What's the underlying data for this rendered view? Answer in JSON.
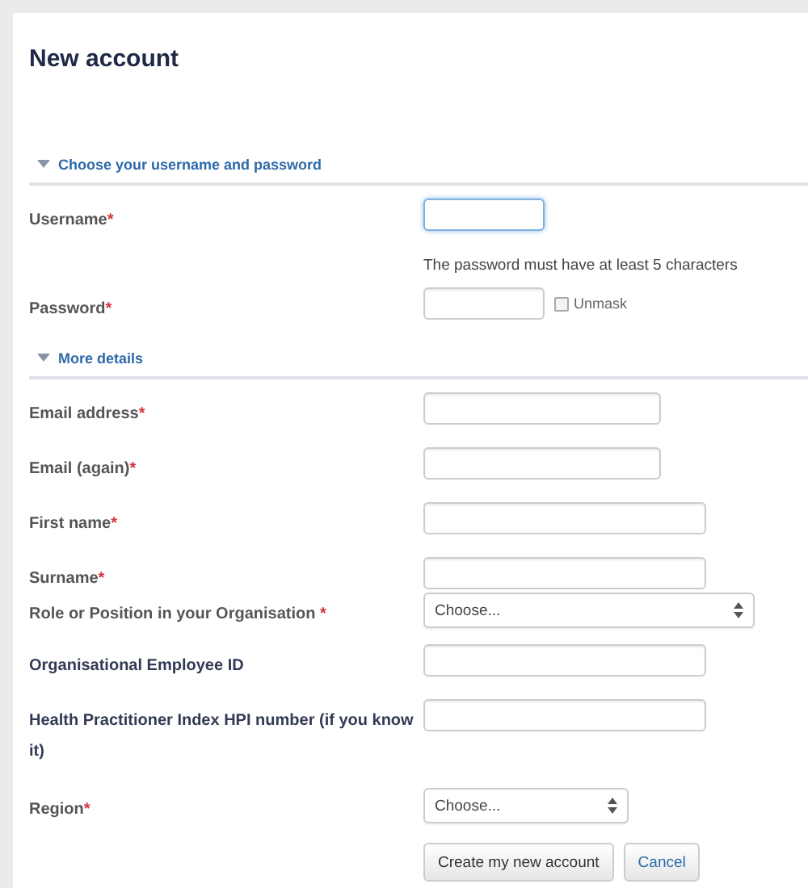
{
  "title": "New account",
  "sections": [
    {
      "heading": "Choose your username and password",
      "expanded": true,
      "fields": [
        {
          "kind": "text",
          "label": "Username",
          "mark": "*",
          "focused": true
        },
        {
          "kind": "hint",
          "text": "The password must have at least 5 characters"
        },
        {
          "kind": "password",
          "label": "Password",
          "mark": "*",
          "focused": false,
          "unmask": {
            "label": "Unmask",
            "checked": false
          }
        }
      ]
    },
    {
      "heading": "More details",
      "expanded": true,
      "fields": [
        {
          "kind": "text",
          "label": "Email address",
          "mark": "*",
          "focused": false
        },
        {
          "kind": "text",
          "label": "Email (again)",
          "mark": "*",
          "focused": false
        },
        {
          "kind": "text",
          "label": "First name",
          "mark": "*",
          "focused": false
        },
        {
          "kind": "text",
          "label": "Surname",
          "mark": "*",
          "focused": false
        },
        {
          "kind": "select",
          "label": "Role or Position in your Organisation",
          "mark": " *",
          "value": "Choose..."
        },
        {
          "kind": "text",
          "label": "Organisational Employee ID",
          "focused": false
        },
        {
          "kind": "text",
          "label": "Health Practitioner Index HPI number (if you know it)",
          "focused": false
        },
        {
          "kind": "select",
          "label": "Region",
          "mark": "*",
          "value": "Choose..."
        }
      ]
    }
  ],
  "buttons": [
    {
      "label": "Create my new account",
      "kind": "primary"
    },
    {
      "label": "Cancel",
      "kind": "cancel"
    }
  ]
}
